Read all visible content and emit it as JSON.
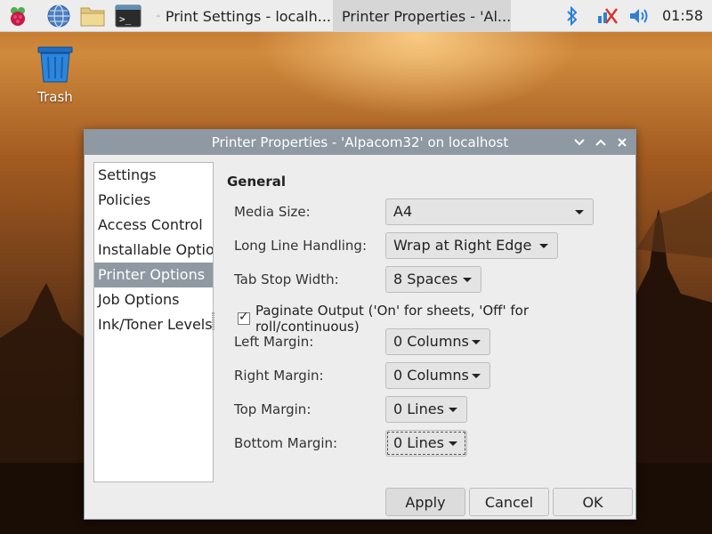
{
  "taskbar": {
    "tasks": [
      {
        "label": "Print Settings - localh..."
      },
      {
        "label": "Printer Properties - 'Al..."
      }
    ],
    "clock": "01:58"
  },
  "desktop": {
    "trash_label": "Trash"
  },
  "window": {
    "title": "Printer Properties - 'Alpacom32' on localhost",
    "sidebar": [
      {
        "label": "Settings"
      },
      {
        "label": "Policies"
      },
      {
        "label": "Access Control"
      },
      {
        "label": "Installable Options"
      },
      {
        "label": "Printer Options"
      },
      {
        "label": "Job Options"
      },
      {
        "label": "Ink/Toner Levels"
      }
    ],
    "section_title": "General",
    "fields": {
      "media_size": {
        "label": "Media Size:",
        "value": "A4"
      },
      "long_line": {
        "label": "Long Line Handling:",
        "value": "Wrap at Right Edge"
      },
      "tab_stop": {
        "label": "Tab Stop Width:",
        "value": "8 Spaces"
      },
      "paginate": {
        "label": "Paginate Output ('On' for sheets, 'Off' for roll/continuous)",
        "checked": true
      },
      "left_margin": {
        "label": "Left Margin:",
        "value": "0 Columns"
      },
      "right_margin": {
        "label": "Right Margin:",
        "value": "0 Columns"
      },
      "top_margin": {
        "label": "Top Margin:",
        "value": "0 Lines"
      },
      "bottom_margin": {
        "label": "Bottom Margin:",
        "value": "0 Lines"
      }
    },
    "buttons": {
      "apply": "Apply",
      "cancel": "Cancel",
      "ok": "OK"
    }
  }
}
